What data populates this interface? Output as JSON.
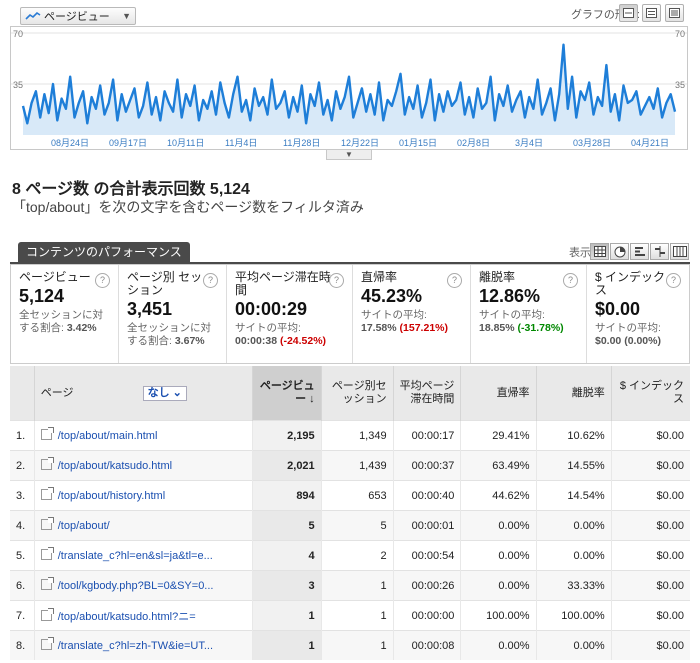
{
  "toolbar": {
    "metric_label": "ページビュー",
    "graph_format_label": "グラフの形式:",
    "display_label": "表示:"
  },
  "chart_data": {
    "type": "line",
    "series": [
      {
        "name": "ページビュー",
        "color": "#1e7ed8"
      }
    ],
    "ylim": [
      0,
      70
    ],
    "yticks": [
      35,
      70
    ],
    "x_tick_labels": [
      "08月24日",
      "09月17日",
      "10月11日",
      "11月4日",
      "11月28日",
      "12月22日",
      "01月15日",
      "02月8日",
      "3月4日",
      "03月28日",
      "04月21日"
    ],
    "values": [
      20,
      8,
      22,
      30,
      12,
      28,
      15,
      35,
      10,
      25,
      18,
      40,
      12,
      22,
      30,
      8,
      26,
      18,
      34,
      14,
      22,
      38,
      10,
      28,
      16,
      24,
      32,
      12,
      20,
      36,
      14,
      26,
      10,
      30,
      22,
      16,
      38,
      12,
      28,
      20,
      34,
      10,
      24,
      18,
      30,
      14,
      36,
      22,
      12,
      28,
      40,
      16,
      24,
      10,
      32,
      20,
      26,
      14,
      38,
      18,
      22,
      30,
      12,
      26,
      16,
      34,
      8,
      28,
      20,
      36,
      14,
      24,
      10,
      30,
      18,
      26,
      40,
      12,
      22,
      32,
      16,
      28,
      14,
      36,
      10,
      24,
      20,
      30,
      42,
      14,
      26,
      18,
      34,
      12,
      22,
      38,
      10,
      28,
      16,
      30,
      20,
      24,
      36,
      14,
      26,
      12,
      32,
      18,
      22,
      40,
      10,
      28,
      20,
      34,
      16,
      24,
      30,
      12,
      26,
      18,
      38,
      14,
      22,
      32,
      10,
      28,
      62,
      18,
      40,
      12,
      30,
      24,
      36,
      14,
      26,
      20,
      48,
      16,
      28,
      10,
      34,
      22,
      24,
      30,
      14,
      20,
      26,
      18,
      32,
      12,
      22,
      28,
      16
    ]
  },
  "summary": {
    "heading": "8 ページ数 の合計表示回数 5,124",
    "subheading": "「top/about」を次の文字を含むページ数をフィルタ済み"
  },
  "tab_label": "コンテンツのパフォーマンス",
  "cards": [
    {
      "title": "ページビュー",
      "value": "5,124",
      "sub1": "全セッションに対",
      "sub2": "する割合: ",
      "sub2b": "3.42%",
      "delta": ""
    },
    {
      "title": "ページ別 セッション",
      "value": "3,451",
      "sub1": "全セッションに対",
      "sub2": "する割合: ",
      "sub2b": "3.67%",
      "delta": ""
    },
    {
      "title": "平均ページ滞在時間",
      "value": "00:00:29",
      "sub1": "サイトの平均:",
      "sub2": "",
      "sub2b": "00:00:38",
      "delta": "(-24.52%)"
    },
    {
      "title": "直帰率",
      "value": "45.23%",
      "sub1": "サイトの平均:",
      "sub2": "",
      "sub2b": "17.58%",
      "delta": "(157.21%)"
    },
    {
      "title": "離脱率",
      "value": "12.86%",
      "sub1": "サイトの平均:",
      "sub2": "",
      "sub2b": "18.85%",
      "delta": "(-31.78%)"
    },
    {
      "title": "$ インデックス",
      "value": "$0.00",
      "sub1": "サイトの平均:",
      "sub2": "",
      "sub2b": "$0.00",
      "delta": "(0.00%)"
    }
  ],
  "table": {
    "headers": {
      "page": "ページ",
      "filter": "なし",
      "pageviews": "ページビュー",
      "sessions": "ページ別セッション",
      "avg_time": "平均ページ滞在時間",
      "bounce": "直帰率",
      "exit": "離脱率",
      "index": "$ インデックス"
    },
    "rows": [
      {
        "n": "1.",
        "page": "/top/about/main.html",
        "pv": "2,195",
        "s": "1,349",
        "t": "00:00:17",
        "b": "29.41%",
        "e": "10.62%",
        "i": "$0.00"
      },
      {
        "n": "2.",
        "page": "/top/about/katsudo.html",
        "pv": "2,021",
        "s": "1,439",
        "t": "00:00:37",
        "b": "63.49%",
        "e": "14.55%",
        "i": "$0.00"
      },
      {
        "n": "3.",
        "page": "/top/about/history.html",
        "pv": "894",
        "s": "653",
        "t": "00:00:40",
        "b": "44.62%",
        "e": "14.54%",
        "i": "$0.00"
      },
      {
        "n": "4.",
        "page": "/top/about/",
        "pv": "5",
        "s": "5",
        "t": "00:00:01",
        "b": "0.00%",
        "e": "0.00%",
        "i": "$0.00"
      },
      {
        "n": "5.",
        "page": "/translate_c?hl=en&sl=ja&tl=e...",
        "pv": "4",
        "s": "2",
        "t": "00:00:54",
        "b": "0.00%",
        "e": "0.00%",
        "i": "$0.00"
      },
      {
        "n": "6.",
        "page": "/tool/kgbody.php?BL=0&SY=0...",
        "pv": "3",
        "s": "1",
        "t": "00:00:26",
        "b": "0.00%",
        "e": "33.33%",
        "i": "$0.00"
      },
      {
        "n": "7.",
        "page": "/top/about/katsudo.html?ニ=",
        "pv": "1",
        "s": "1",
        "t": "00:00:00",
        "b": "100.00%",
        "e": "100.00%",
        "i": "$0.00"
      },
      {
        "n": "8.",
        "page": "/translate_c?hl=zh-TW&ie=UT...",
        "pv": "1",
        "s": "1",
        "t": "00:00:08",
        "b": "0.00%",
        "e": "0.00%",
        "i": "$0.00"
      }
    ]
  }
}
